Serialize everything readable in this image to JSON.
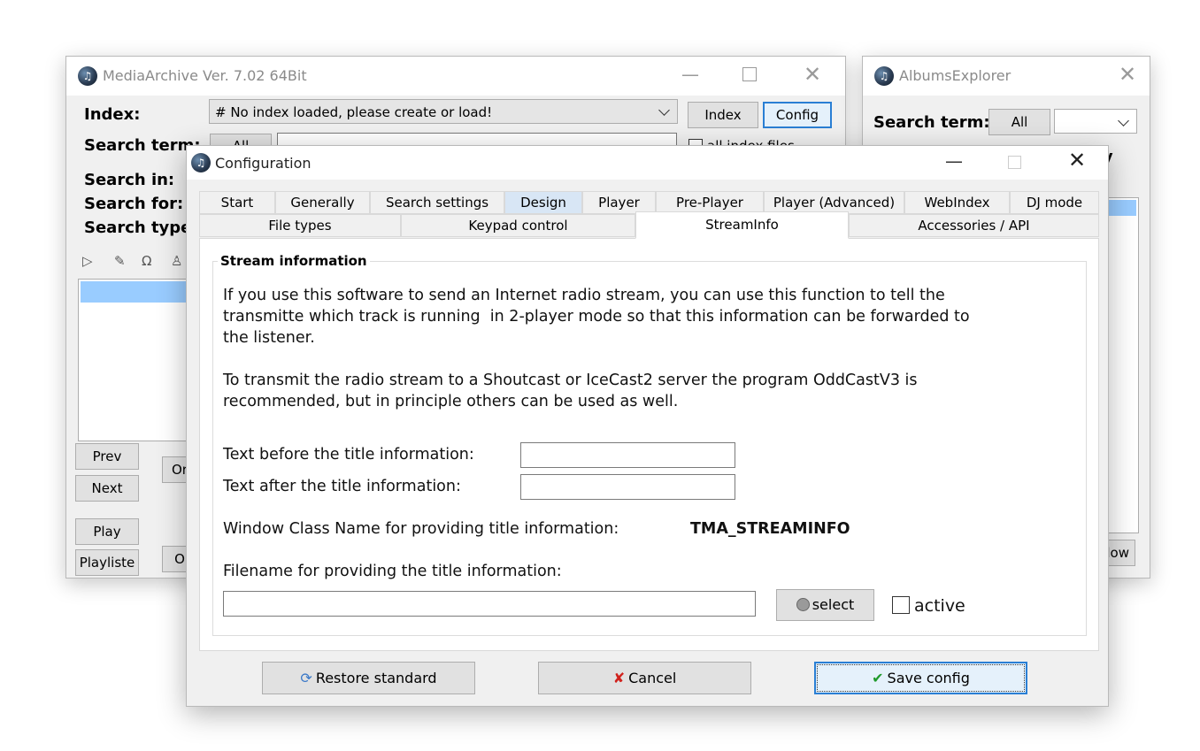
{
  "media_archive": {
    "title": "MediaArchive Ver. 7.02 64Bit",
    "index_label": "Index:",
    "index_value": "# No index loaded, please create or load!",
    "index_button": "Index",
    "config_button": "Config",
    "search_term_label": "Search term:",
    "all_button": "All",
    "all_index_files_label": "all index files",
    "search_in_label": "Search in:",
    "search_for_label": "Search for:",
    "search_type_label": "Search type:",
    "prev_button": "Prev",
    "next_button": "Next",
    "play_button": "Play",
    "playlist_button": "Playliste",
    "o_button_1": "Or",
    "o_button_2": "O"
  },
  "albums_explorer": {
    "title": "AlbumsExplorer",
    "search_term_label": "Search term:",
    "all_button": "All",
    "partial_label": "ry",
    "partial_button": "low"
  },
  "config": {
    "title": "Configuration",
    "tabs_row1": [
      "Start",
      "Generally",
      "Search settings",
      "Design",
      "Player",
      "Pre-Player",
      "Player (Advanced)",
      "WebIndex",
      "DJ mode"
    ],
    "tabs_row2": [
      "File types",
      "Keypad control",
      "StreamInfo",
      "Accessories / API"
    ],
    "active_tab": "StreamInfo",
    "group_title": "Stream information",
    "para1_line1": "If you use this software to send an Internet radio stream, you can use this function to tell the",
    "para1_line2": "transmitte which track is running  in 2-player mode so that this information can be forwarded to",
    "para1_line3": "the listener.",
    "para2_line1": "To transmit the radio stream to a Shoutcast or IceCast2 server the program OddCastV3 is",
    "para2_line2": "recommended, but in principle others can be used as well.",
    "text_before_label": "Text before the title information:",
    "text_before_value": "",
    "text_after_label": "Text after the title information:",
    "text_after_value": "",
    "window_class_label": "Window Class Name for providing title information:",
    "window_class_value": "TMA_STREAMINFO",
    "filename_label": "Filename for providing the title information:",
    "filename_value": "",
    "select_button": "select",
    "active_label": "active",
    "restore_button": "Restore standard",
    "cancel_button": "Cancel",
    "save_button": "Save config"
  }
}
